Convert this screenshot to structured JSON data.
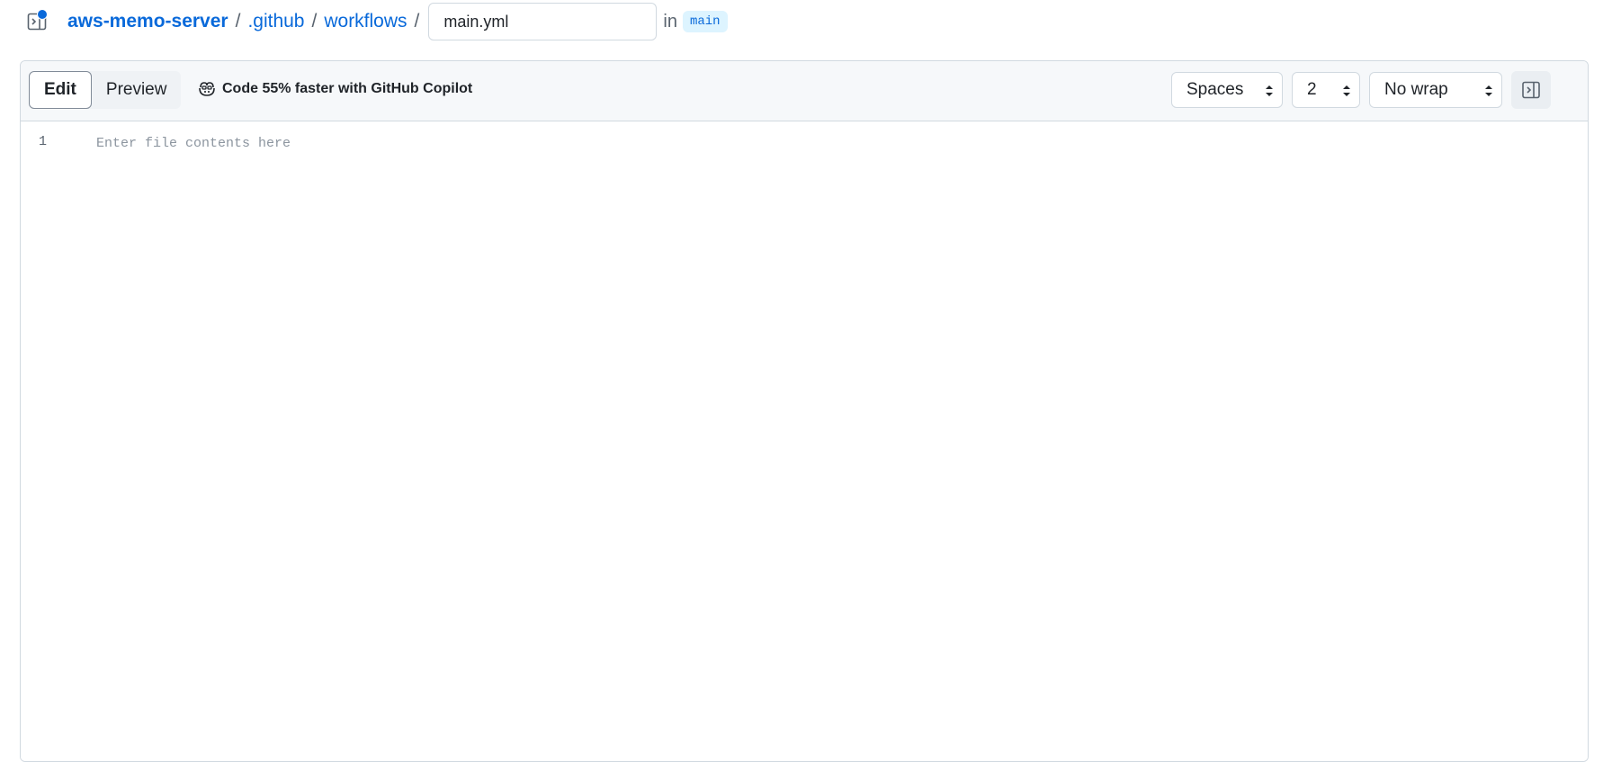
{
  "breadcrumb": {
    "repo": "aws-memo-server",
    "folder1": ".github",
    "folder2": "workflows",
    "separator": "/",
    "filename_value": "main.yml",
    "in_label": "in",
    "branch": "main"
  },
  "toolbar": {
    "edit_label": "Edit",
    "preview_label": "Preview",
    "copilot_label": "Code 55% faster with GitHub Copilot",
    "indent_mode": "Spaces",
    "indent_size": "2",
    "wrap_mode": "No wrap"
  },
  "editor": {
    "line_number": "1",
    "placeholder": "Enter file contents here",
    "content": ""
  },
  "colors": {
    "accent": "#0969da",
    "toolbar_bg": "#f6f8fa",
    "border": "#d1d9e0",
    "badge_bg": "#ddf4ff"
  },
  "icons": {
    "sidebar_toggle": "sidebar-expand-icon",
    "copilot": "copilot-icon",
    "panel": "split-panel-icon",
    "select_caret": "unfold-icon"
  }
}
